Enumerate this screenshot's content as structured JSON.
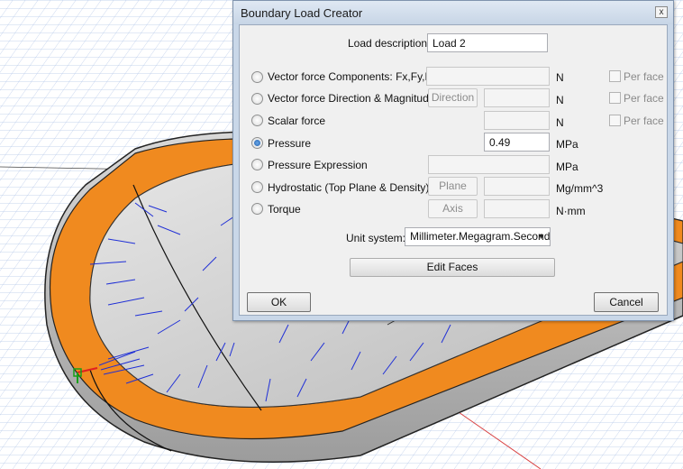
{
  "dialog": {
    "title": "Boundary Load Creator",
    "close_glyph": "x",
    "load_description": {
      "label": "Load description:",
      "value": "Load 2"
    },
    "options": [
      {
        "label": "Vector force Components: Fx,Fy,Fz",
        "unit": "N",
        "per_face": "Per face",
        "selected": false
      },
      {
        "label": "Vector force Direction & Magnitude",
        "button": "Direction",
        "unit": "N",
        "per_face": "Per face",
        "selected": false
      },
      {
        "label": "Scalar force",
        "unit": "N",
        "per_face": "Per face",
        "selected": false
      },
      {
        "label": "Pressure",
        "value": "0.49",
        "unit": "MPa",
        "selected": true
      },
      {
        "label": "Pressure Expression",
        "unit": "MPa",
        "selected": false
      },
      {
        "label": "Hydrostatic (Top Plane & Density)",
        "button": "Plane",
        "unit": "Mg/mm^3",
        "selected": false
      },
      {
        "label": "Torque",
        "button": "Axis",
        "unit": "N·mm",
        "selected": false
      }
    ],
    "unit_system": {
      "label": "Unit system:",
      "value": "Millimeter.Megagram.Second"
    },
    "edit_faces_label": "Edit Faces",
    "ok_label": "OK",
    "cancel_label": "Cancel"
  },
  "colors": {
    "rim": "#f08a1f",
    "arrows": "#1f2fd6",
    "grid": "#9fb7e0",
    "surface": "#c9c9c9"
  }
}
